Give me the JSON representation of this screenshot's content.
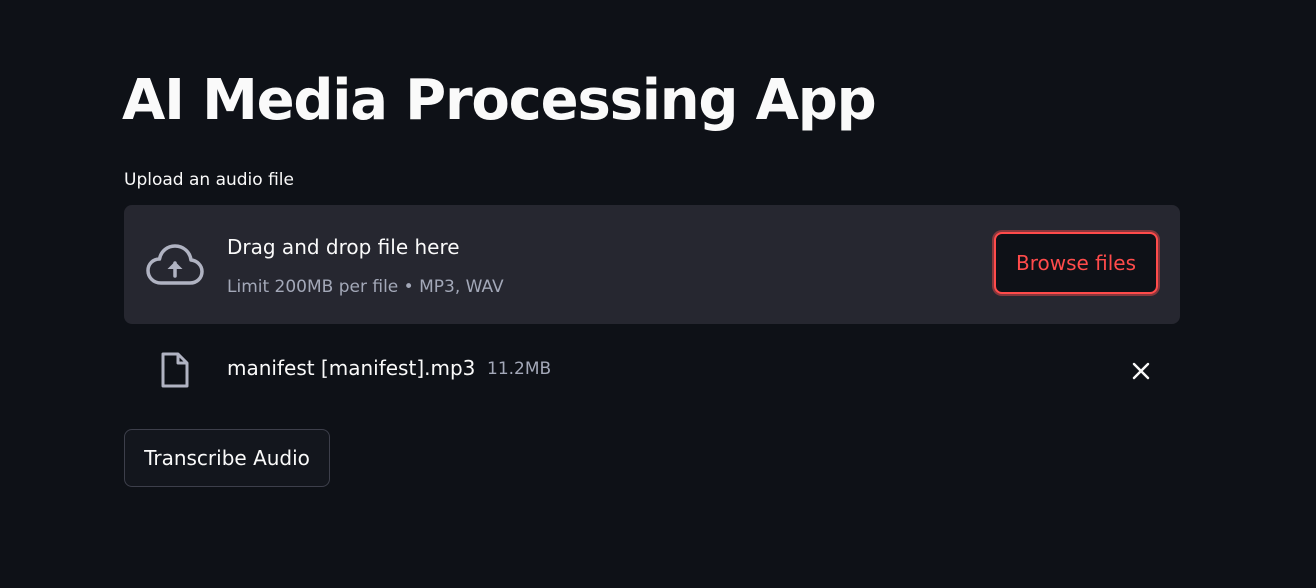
{
  "page": {
    "title": "AI Media Processing App"
  },
  "uploader": {
    "label": "Upload an audio file",
    "dropzone_title": "Drag and drop file here",
    "dropzone_limit": "Limit 200MB per file • MP3, WAV",
    "browse_label": "Browse files",
    "cloud_icon": "cloud-upload-icon"
  },
  "uploaded_file": {
    "name": "manifest [manifest].mp3",
    "size": "11.2MB",
    "file_icon": "file-icon",
    "remove_icon": "close-icon"
  },
  "actions": {
    "transcribe_label": "Transcribe Audio"
  },
  "colors": {
    "background": "#0e1117",
    "dropzone": "#262730",
    "accent": "#ff4b4b",
    "muted_text": "#a3a8b8",
    "text": "#fafafa"
  }
}
